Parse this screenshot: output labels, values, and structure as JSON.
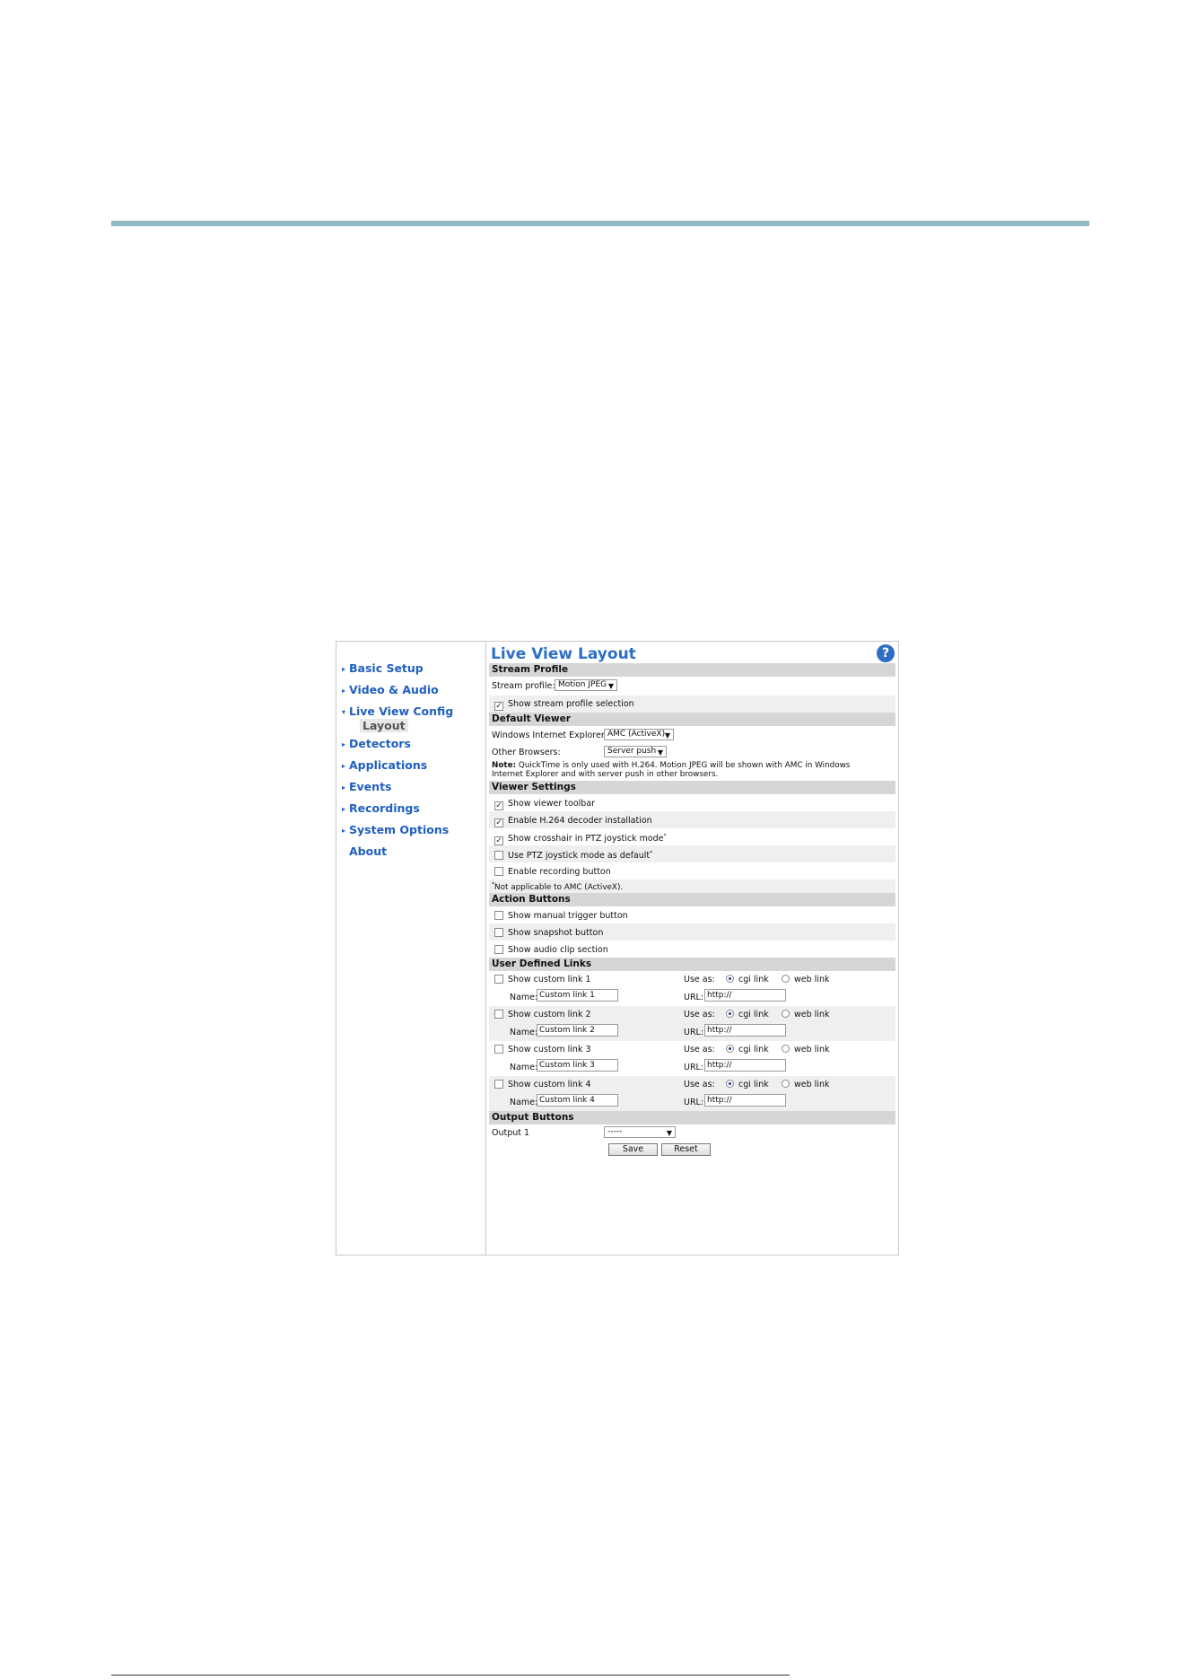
{
  "nav": {
    "items": [
      {
        "label": "Basic Setup"
      },
      {
        "label": "Video & Audio"
      },
      {
        "label": "Live View Config",
        "expanded": true
      },
      {
        "label": "Detectors"
      },
      {
        "label": "Applications"
      },
      {
        "label": "Events"
      },
      {
        "label": "Recordings"
      },
      {
        "label": "System Options"
      },
      {
        "label": "About"
      }
    ],
    "sub_item": "Layout",
    "expand_arrow": "▸",
    "expanded_arrow": "▾"
  },
  "page": {
    "title": "Live View Layout",
    "help_icon": "?"
  },
  "stream_profile": {
    "heading": "Stream Profile",
    "label": "Stream profile:",
    "value": "Motion JPEG",
    "show_selection_label": "Show stream profile selection",
    "show_selection_checked": true
  },
  "default_viewer": {
    "heading": "Default Viewer",
    "ie_label": "Windows Internet Explorer:",
    "ie_value": "AMC (ActiveX)",
    "other_label": "Other Browsers:",
    "other_value": "Server push",
    "note_bold": "Note:",
    "note_line1": "QuickTime is only used with H.264. Motion JPEG will be shown with AMC in Windows",
    "note_line2": "Internet Explorer and with server push in other browsers."
  },
  "viewer_settings": {
    "heading": "Viewer Settings",
    "options": [
      {
        "label": "Show viewer toolbar",
        "checked": true
      },
      {
        "label": "Enable H.264 decoder installation",
        "checked": true
      },
      {
        "label": "Show crosshair in PTZ joystick mode",
        "checked": true,
        "star": "*"
      },
      {
        "label": "Use PTZ joystick mode as default",
        "checked": false,
        "star": "*"
      },
      {
        "label": "Enable recording button",
        "checked": false
      }
    ],
    "footnote_star": "*",
    "footnote": "Not applicable to AMC (ActiveX)."
  },
  "action_buttons": {
    "heading": "Action Buttons",
    "options": [
      {
        "label": "Show manual trigger button",
        "checked": false
      },
      {
        "label": "Show snapshot button",
        "checked": false
      },
      {
        "label": "Show audio clip section",
        "checked": false
      }
    ]
  },
  "user_links": {
    "heading": "User Defined Links",
    "use_as_label": "Use as:",
    "cgi_label": "cgi link",
    "web_label": "web link",
    "name_label": "Name:",
    "url_label": "URL:",
    "links": [
      {
        "label": "Show custom link 1",
        "name": "Custom link 1",
        "url": "http://",
        "mode": "cgi"
      },
      {
        "label": "Show custom link 2",
        "name": "Custom link 2",
        "url": "http://",
        "mode": "cgi"
      },
      {
        "label": "Show custom link 3",
        "name": "Custom link 3",
        "url": "http://",
        "mode": "cgi"
      },
      {
        "label": "Show custom link 4",
        "name": "Custom link 4",
        "url": "http://",
        "mode": "cgi"
      }
    ]
  },
  "output_buttons": {
    "heading": "Output Buttons",
    "output_label": "Output 1",
    "output_value": "-----"
  },
  "buttons": {
    "save": "Save",
    "reset": "Reset"
  },
  "colors": {
    "accent_blue": "#2b6fc6",
    "section_gray": "#d6d6d6",
    "rule_teal": "#8fb7c4"
  }
}
